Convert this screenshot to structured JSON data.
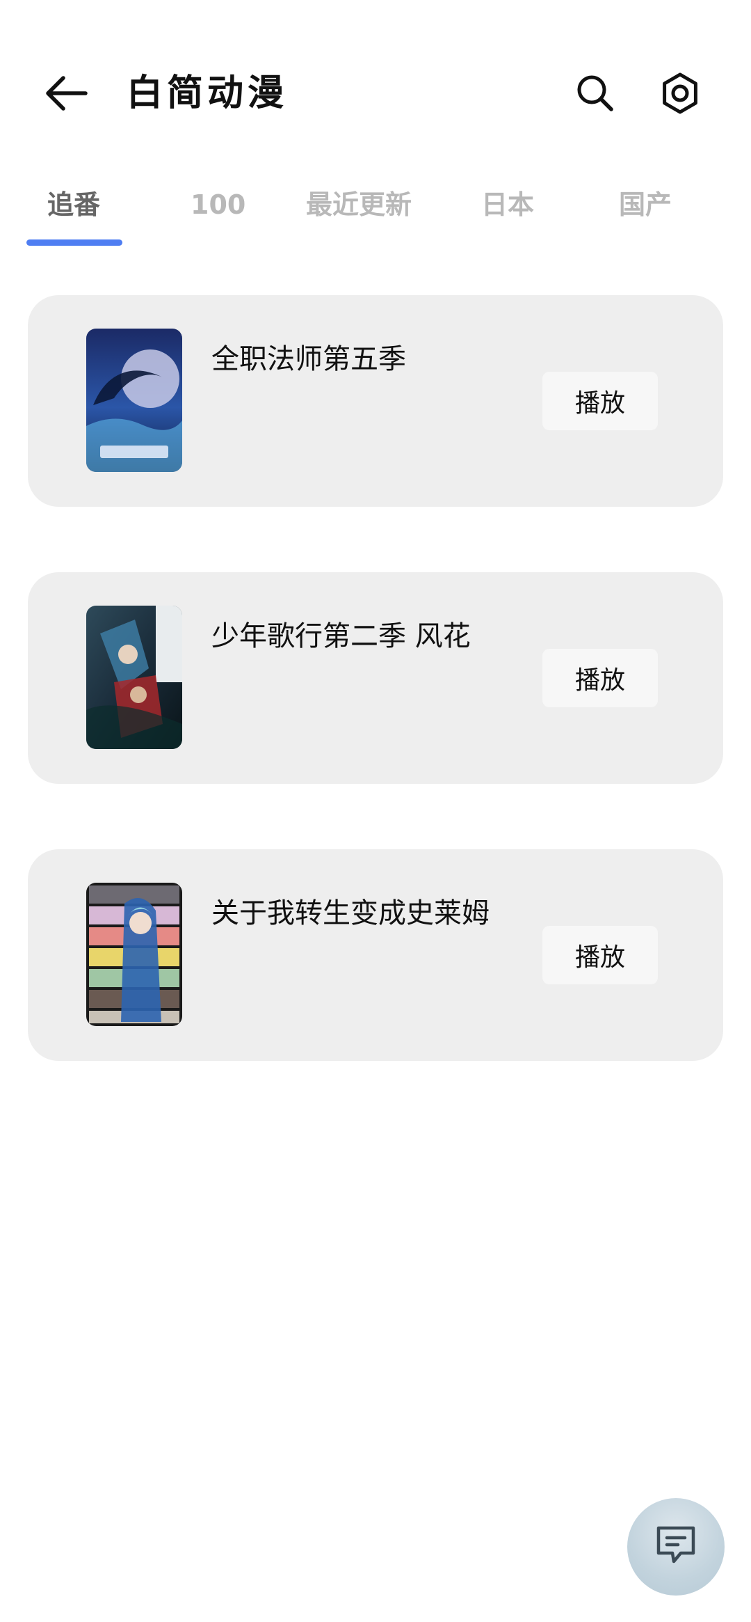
{
  "header": {
    "title": "白简动漫",
    "back_icon": "arrow-left-icon",
    "search_icon": "search-icon",
    "settings_icon": "gear-icon"
  },
  "tabs": [
    {
      "label": "追番",
      "active": true
    },
    {
      "label": "100",
      "active": false
    },
    {
      "label": "最近更新",
      "active": false
    },
    {
      "label": "日本",
      "active": false
    },
    {
      "label": "国产",
      "active": false
    }
  ],
  "accent_color": "#4f7ef2",
  "cards": [
    {
      "title": "全职法师第五季",
      "play_label": "播放"
    },
    {
      "title": "少年歌行第二季 风花",
      "play_label": "播放"
    },
    {
      "title": "关于我转生变成史莱姆",
      "play_label": "播放"
    }
  ],
  "fab": {
    "icon": "chat-message-icon"
  }
}
